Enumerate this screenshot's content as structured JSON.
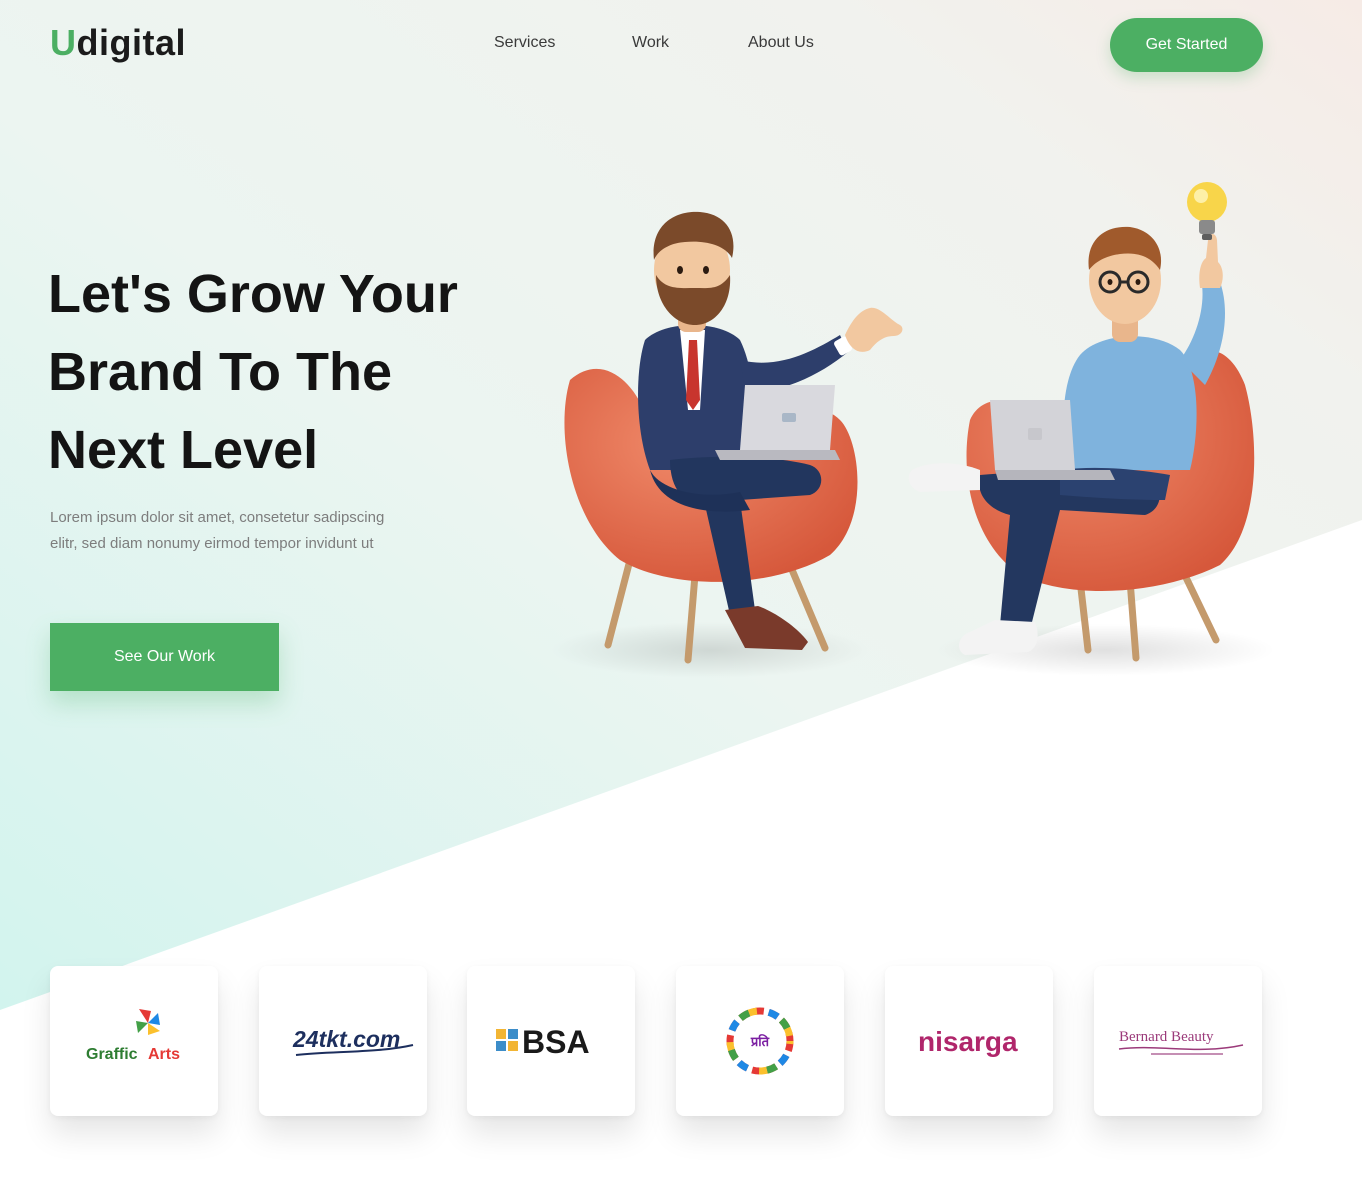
{
  "brand": {
    "logo_initial": "U",
    "logo_rest": "digital",
    "accent": "#4caf63"
  },
  "nav": {
    "items": [
      {
        "label": "Services"
      },
      {
        "label": "Work"
      },
      {
        "label": "About Us"
      }
    ],
    "cta_label": "Get Started"
  },
  "hero": {
    "title_line1": "Let's Grow Your",
    "title_line2": "Brand To The",
    "title_line3": "Next Level",
    "description_line1": "Lorem ipsum dolor sit amet, consetetur sadipscing",
    "description_line2": "elitr, sed diam nonumy eirmod tempor invidunt ut",
    "button_label": "See Our Work"
  },
  "clients": [
    {
      "name_part1": "Graffic",
      "name_part2": "Arts"
    },
    {
      "name": "24tkt.com"
    },
    {
      "name": "BSA"
    },
    {
      "name": "प्रति"
    },
    {
      "name": "nisarga"
    },
    {
      "name": "Bernard Beauty"
    }
  ]
}
